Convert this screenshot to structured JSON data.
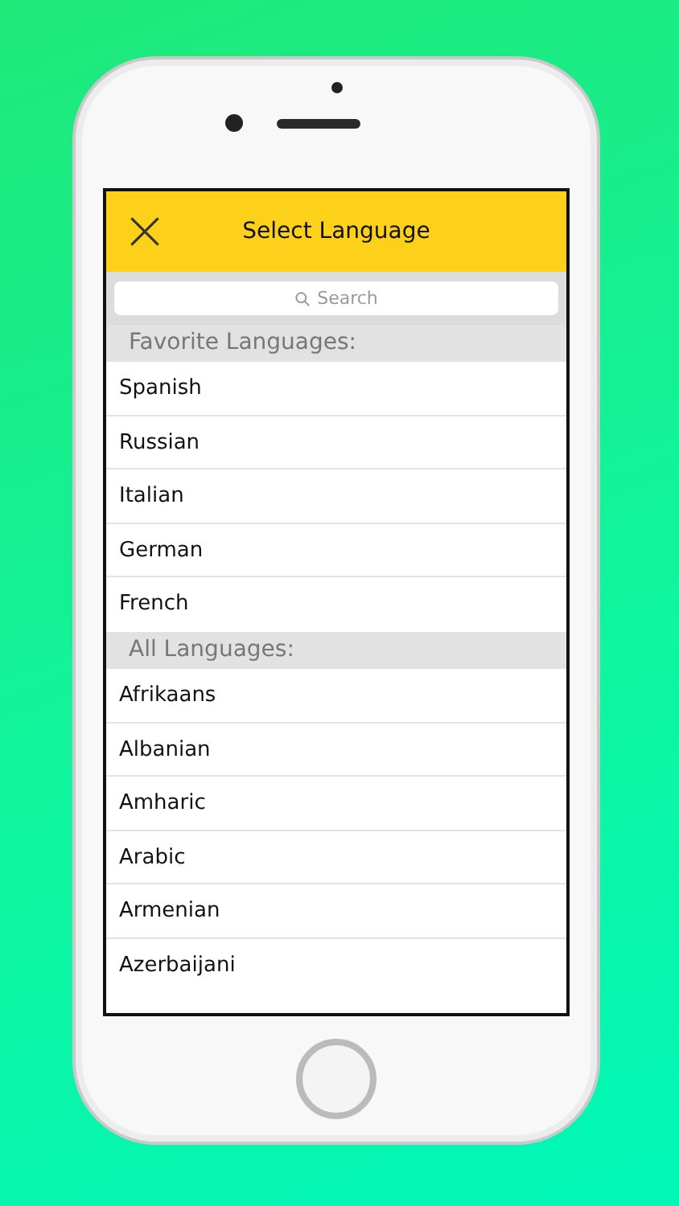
{
  "header": {
    "title": "Select Language"
  },
  "search": {
    "placeholder": "Search"
  },
  "sections": [
    {
      "title": "Favorite Languages:",
      "items": [
        "Spanish",
        "Russian",
        "Italian",
        "German",
        "French"
      ]
    },
    {
      "title": "All Languages:",
      "items": [
        "Afrikaans",
        "Albanian",
        "Amharic",
        "Arabic",
        "Armenian",
        "Azerbaijani"
      ]
    }
  ]
}
